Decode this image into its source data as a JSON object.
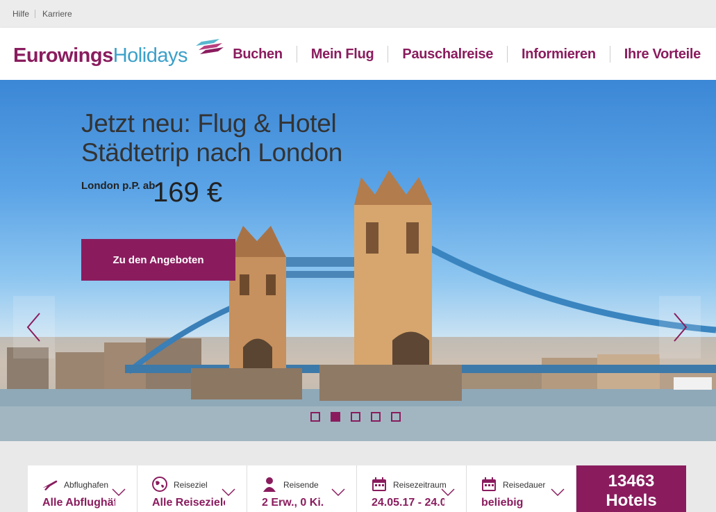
{
  "utility_nav": {
    "help": "Hilfe",
    "careers": "Karriere"
  },
  "brand": {
    "name_primary": "Eurowings",
    "name_secondary": "Holidays",
    "color_primary": "#8a1c5e",
    "color_secondary": "#3aa0c9"
  },
  "main_nav": [
    {
      "label": "Buchen"
    },
    {
      "label": "Mein Flug"
    },
    {
      "label": "Pauschalreise"
    },
    {
      "label": "Informieren"
    },
    {
      "label": "Ihre Vorteile"
    }
  ],
  "hero": {
    "title_line1": "Jetzt neu: Flug & Hotel",
    "title_line2": "Städtetrip nach London",
    "price_label": "London p.P. ab",
    "price": "169 €",
    "cta_label": "Zu den Angeboten",
    "prev_icon": "chevron-left-icon",
    "next_icon": "chevron-right-icon",
    "slide_count": 5,
    "active_slide": 2
  },
  "search": {
    "fields": [
      {
        "label": "Abflughafen",
        "value": "Alle Abflughäfe",
        "icon": "plane-icon"
      },
      {
        "label": "Reiseziel",
        "value": "Alle Reiseziele",
        "icon": "globe-icon"
      },
      {
        "label": "Reisende",
        "value": "2 Erw., 0 Ki.",
        "icon": "traveler-icon"
      },
      {
        "label": "Reisezeitraum",
        "value": "24.05.17 - 24.0",
        "icon": "calendar-icon"
      },
      {
        "label": "Reisedauer",
        "value": "beliebig",
        "icon": "calendar-icon"
      }
    ],
    "hotels_count": "13463",
    "hotels_label": "Hotels"
  }
}
